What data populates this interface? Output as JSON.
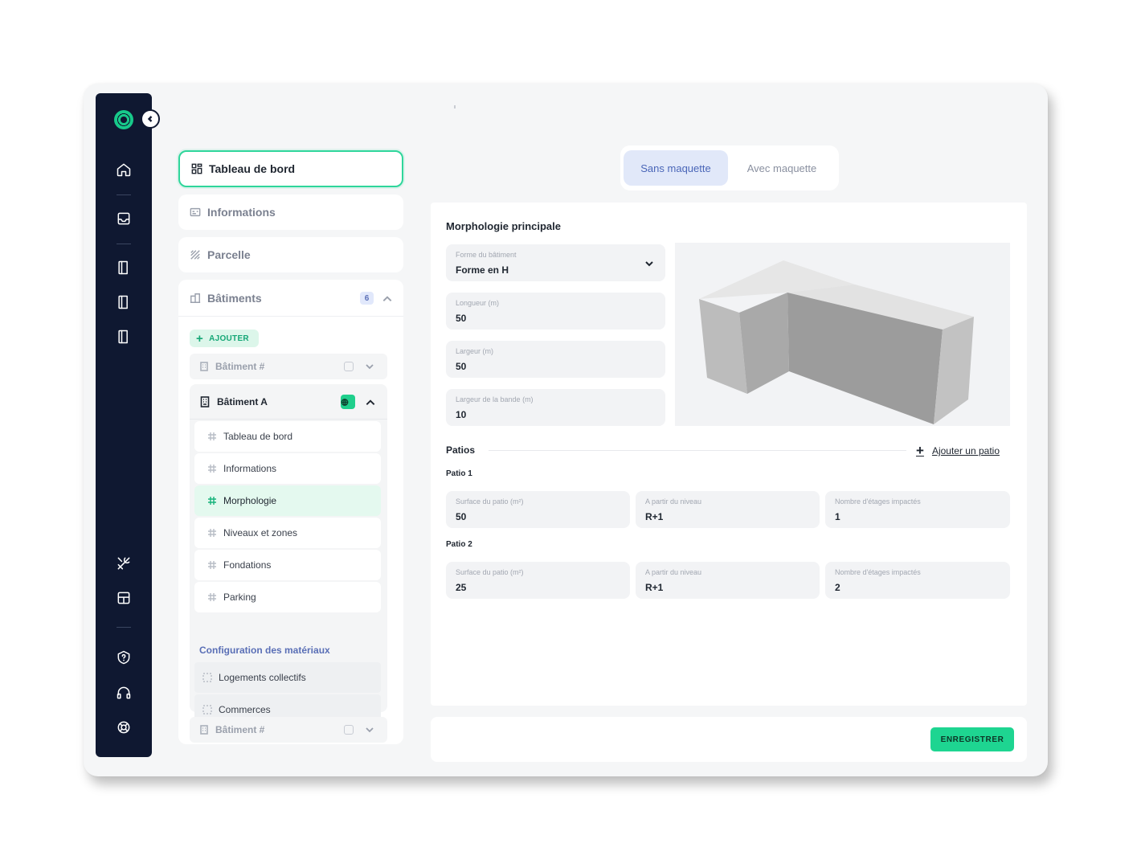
{
  "view_toggle": {
    "selected": "Sans maquette",
    "other": "Avec maquette"
  },
  "nav": {
    "dashboard": "Tableau de bord",
    "informations": "Informations",
    "parcelle": "Parcelle",
    "batiments": {
      "label": "Bâtiments",
      "count": "6"
    }
  },
  "buildings": {
    "add_label": "AJOUTER",
    "collapsed_top": "Bâtiment #",
    "collapsed_bottom": "Bâtiment #",
    "open": {
      "label": "Bâtiment A",
      "items": [
        "Tableau de bord",
        "Informations",
        "Morphologie",
        "Niveaux et zones",
        "Fondations",
        "Parking"
      ],
      "active_item": "Morphologie",
      "config_title": "Configuration des matériaux",
      "config_items": [
        "Logements collectifs",
        "Commerces"
      ]
    }
  },
  "morphologie": {
    "title": "Morphologie principale",
    "forme": {
      "label": "Forme du bâtiment",
      "value": "Forme en H"
    },
    "longueur": {
      "label": "Longueur (m)",
      "value": "50"
    },
    "largeur": {
      "label": "Largeur (m)",
      "value": "50"
    },
    "largeur_bande": {
      "label": "Largeur de la bande (m)",
      "value": "10"
    }
  },
  "patios": {
    "title": "Patios",
    "add_label": "Ajouter un patio",
    "list": [
      {
        "title": "Patio 1",
        "surface": {
          "label": "Surface du patio (m²)",
          "value": "50"
        },
        "niveau": {
          "label": "A partir du niveau",
          "value": "R+1"
        },
        "etages": {
          "label": "Nombre d'étages impactés",
          "value": "1"
        }
      },
      {
        "title": "Patio 2",
        "surface": {
          "label": "Surface du patio (m²)",
          "value": "25"
        },
        "niveau": {
          "label": "A partir du niveau",
          "value": "R+1"
        },
        "etages": {
          "label": "Nombre d'étages impactés",
          "value": "2"
        }
      }
    ]
  },
  "footer": {
    "save_label": "ENREGISTRER"
  },
  "colors": {
    "rail": "#0f1831",
    "accent": "#1ed591",
    "toggle_active": "#e1e8f9"
  },
  "icons": {
    "rail": [
      "home-icon",
      "inbox-icon",
      "book-icon",
      "book-icon",
      "book-icon",
      "tools-icon",
      "layout-icon",
      "help-icon",
      "headset-icon",
      "lifebuoy-icon"
    ]
  }
}
